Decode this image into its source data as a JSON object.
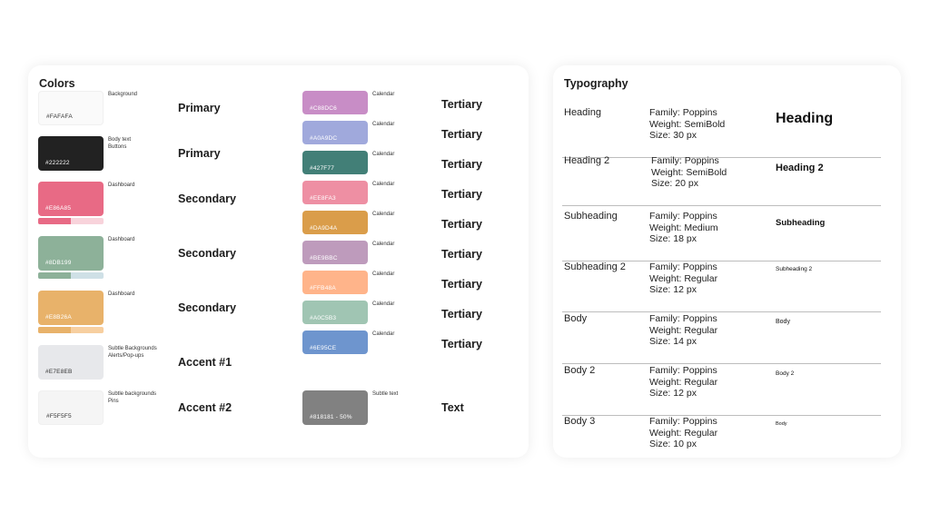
{
  "colors": {
    "title": "Colors",
    "left_swatches": [
      {
        "hex": "#FAFAFA",
        "color": "#FAFAFA",
        "text_color": "#333333",
        "labels": [
          "Background"
        ],
        "role": "Primary",
        "bar": null
      },
      {
        "hex": "#222222",
        "color": "#222222",
        "text_color": "#ffffff",
        "labels": [
          "Body text",
          "Buttons"
        ],
        "role": "Primary",
        "bar": null
      },
      {
        "hex": "#E86A85",
        "color": "#E86A85",
        "text_color": "#ffffff",
        "labels": [
          "Dashboard"
        ],
        "role": "Secondary",
        "bar": {
          "fill": "#E86A85",
          "track": "#F8D3DB"
        }
      },
      {
        "hex": "#8DB199",
        "color": "#8DB199",
        "text_color": "#ffffff",
        "labels": [
          "Dashboard"
        ],
        "role": "Secondary",
        "bar": {
          "fill": "#8DB199",
          "track": "#CFE0E6"
        }
      },
      {
        "hex": "#E8B26A",
        "color": "#E8B26A",
        "text_color": "#ffffff",
        "labels": [
          "Dashboard"
        ],
        "role": "Secondary",
        "bar": {
          "fill": "#E8B26A",
          "track": "#F7CFA0"
        }
      },
      {
        "hex": "#E7E8EB",
        "color": "#E7E8EB",
        "text_color": "#333333",
        "labels": [
          "Subtle Backgrounds",
          "Alerts/Pop-ups"
        ],
        "role": "Accent #1",
        "bar": null
      },
      {
        "hex": "#F5F5F5",
        "color": "#F5F5F5",
        "text_color": "#333333",
        "labels": [
          "Subtle backgrounds",
          "Pins"
        ],
        "role": "Accent #2",
        "bar": null
      }
    ],
    "right_swatches": [
      {
        "hex": "#C88DC6",
        "color": "#C88DC6",
        "text_color": "#ffffff",
        "labels": [
          "Calendar"
        ],
        "role": "Tertiary"
      },
      {
        "hex": "#A0A9DC",
        "color": "#A0A9DC",
        "text_color": "#ffffff",
        "labels": [
          "Calendar"
        ],
        "role": "Tertiary"
      },
      {
        "hex": "#427F77",
        "color": "#427F77",
        "text_color": "#ffffff",
        "labels": [
          "Calendar"
        ],
        "role": "Tertiary"
      },
      {
        "hex": "#EE8FA3",
        "color": "#EE8FA3",
        "text_color": "#ffffff",
        "labels": [
          "Calendar"
        ],
        "role": "Tertiary"
      },
      {
        "hex": "#DA9D4A",
        "color": "#DA9D4A",
        "text_color": "#ffffff",
        "labels": [
          "Calendar"
        ],
        "role": "Tertiary"
      },
      {
        "hex": "#BE9BBC",
        "color": "#BE9BBC",
        "text_color": "#ffffff",
        "labels": [
          "Calendar"
        ],
        "role": "Tertiary"
      },
      {
        "hex": "#FFB48A",
        "color": "#FFB48A",
        "text_color": "#ffffff",
        "labels": [
          "Calendar"
        ],
        "role": "Tertiary"
      },
      {
        "hex": "#A0C5B3",
        "color": "#A0C5B3",
        "text_color": "#ffffff",
        "labels": [
          "Calendar"
        ],
        "role": "Tertiary"
      },
      {
        "hex": "#6E95CE",
        "color": "#6E95CE",
        "text_color": "#ffffff",
        "labels": [
          "Calendar"
        ],
        "role": "Tertiary"
      }
    ],
    "text_swatch": {
      "hex": "#818181 - 50%",
      "color": "#818181",
      "text_color": "#ffffff",
      "labels": [
        "Subtle text"
      ],
      "role": "Text"
    }
  },
  "typography": {
    "title": "Typography",
    "rows": [
      {
        "name": "Heading",
        "family": "Family: Poppins",
        "weight": "Weight: SemiBold",
        "size": "Size: 30 px",
        "sample": "Heading"
      },
      {
        "name": "Heading 2",
        "family": "Family: Poppins",
        "weight": "Weight: SemiBold",
        "size": "Size: 20 px",
        "sample": "Heading 2"
      },
      {
        "name": "Subheading",
        "family": "Family: Poppins",
        "weight": "Weight: Medium",
        "size": "Size: 18 px",
        "sample": "Subheading"
      },
      {
        "name": "Subheading 2",
        "family": "Family: Poppins",
        "weight": "Weight: Regular",
        "size": "Size: 12 px",
        "sample": "Subheading 2"
      },
      {
        "name": "Body",
        "family": "Family: Poppins",
        "weight": "Weight: Regular",
        "size": "Size: 14 px",
        "sample": "Body"
      },
      {
        "name": "Body 2",
        "family": "Family: Poppins",
        "weight": "Weight: Regular",
        "size": "Size: 12 px",
        "sample": "Body 2"
      },
      {
        "name": "Body 3",
        "family": "Family: Poppins",
        "weight": "Weight: Regular",
        "size": "Size: 10 px",
        "sample": "Body"
      }
    ]
  }
}
